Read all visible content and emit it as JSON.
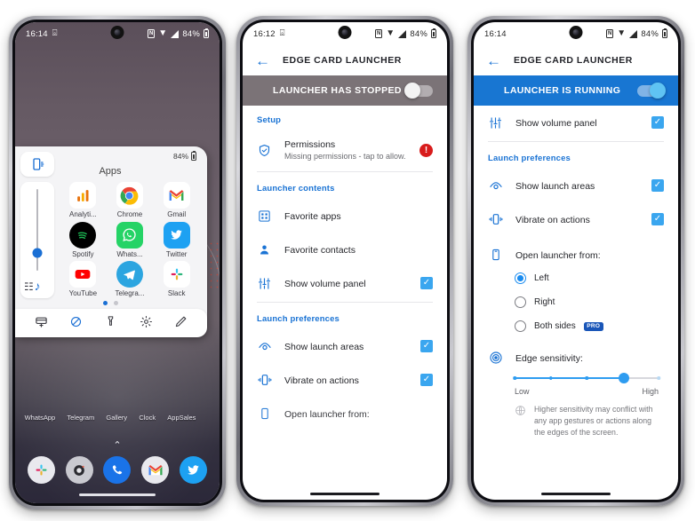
{
  "phone1": {
    "statusbar": {
      "time": "16:14",
      "mail_icon": "gmail-m-icon",
      "nfc": "N",
      "battery_pct": "84%"
    },
    "card": {
      "device_icon": "phone-vibrate-icon",
      "battery_pct": "84%",
      "title": "Apps",
      "volume": {
        "icon": "music-note-icon",
        "eq_icon": "equalizer-icon",
        "level_pct": 22
      },
      "apps": [
        {
          "label": "Analyti...",
          "icon": "google-analytics-icon"
        },
        {
          "label": "Chrome",
          "icon": "chrome-icon"
        },
        {
          "label": "Gmail",
          "icon": "gmail-icon"
        },
        {
          "label": "Spotify",
          "icon": "spotify-icon"
        },
        {
          "label": "Whats...",
          "icon": "whatsapp-icon"
        },
        {
          "label": "Twitter",
          "icon": "twitter-icon"
        },
        {
          "label": "YouTube",
          "icon": "youtube-icon"
        },
        {
          "label": "Telegra...",
          "icon": "telegram-icon"
        },
        {
          "label": "Slack",
          "icon": "slack-icon"
        }
      ],
      "page_dots": {
        "count": 2,
        "active": 0
      },
      "quick_actions": [
        {
          "label": "WhatsApp",
          "icon": "card-add-icon"
        },
        {
          "label": "Telegram",
          "icon": "rotation-lock-icon"
        },
        {
          "label": "Gallery",
          "icon": "flashlight-icon"
        },
        {
          "label": "Clock",
          "icon": "gear-icon"
        },
        {
          "label": "AppSales",
          "icon": "pencil-icon"
        }
      ]
    },
    "home": {
      "chevron": "⌃",
      "dock": [
        {
          "icon": "slack-icon"
        },
        {
          "icon": "camera-icon"
        },
        {
          "icon": "phone-icon"
        },
        {
          "icon": "gmail-icon"
        },
        {
          "icon": "twitter-icon"
        }
      ]
    }
  },
  "phone2": {
    "statusbar": {
      "time": "16:12",
      "mail_icon": "gmail-m-icon",
      "nfc": "N",
      "battery_pct": "84%"
    },
    "appbar": {
      "back_icon": "back-arrow-icon",
      "title": "EDGE CARD LAUNCHER"
    },
    "master_toggle": {
      "label": "LAUNCHER HAS STOPPED",
      "state": "off",
      "color": "#7b7377"
    },
    "sections": [
      {
        "heading": "Setup",
        "rows": [
          {
            "icon": "shield-check-icon",
            "title": "Permissions",
            "subtitle": "Missing permissions - tap to allow.",
            "badge": "!"
          }
        ]
      },
      {
        "heading": "Launcher contents",
        "rows": [
          {
            "icon": "grid-apps-icon",
            "title": "Favorite apps"
          },
          {
            "icon": "person-icon",
            "title": "Favorite contacts"
          },
          {
            "icon": "sliders-icon",
            "title": "Show volume panel",
            "checked": true
          }
        ]
      },
      {
        "heading": "Launch preferences",
        "rows": [
          {
            "icon": "eye-icon",
            "title": "Show launch areas",
            "checked": true
          },
          {
            "icon": "vibrate-icon",
            "title": "Vibrate on actions",
            "checked": true
          },
          {
            "icon": "phone-outline-icon",
            "title": "Open launcher from:"
          }
        ]
      }
    ]
  },
  "phone3": {
    "statusbar": {
      "time": "16:14",
      "nfc": "N",
      "battery_pct": "84%"
    },
    "appbar": {
      "back_icon": "back-arrow-icon",
      "title": "EDGE CARD LAUNCHER"
    },
    "master_toggle": {
      "label": "LAUNCHER IS RUNNING",
      "state": "on",
      "color": "#1876d2"
    },
    "top_row": {
      "icon": "sliders-icon",
      "title": "Show volume panel",
      "checked": true
    },
    "section_heading": "Launch preferences",
    "rows": [
      {
        "icon": "eye-icon",
        "title": "Show launch areas",
        "checked": true
      },
      {
        "icon": "vibrate-icon",
        "title": "Vibrate on actions",
        "checked": true
      }
    ],
    "open_from": {
      "icon": "phone-outline-icon",
      "title": "Open launcher from:",
      "options": [
        {
          "label": "Left",
          "selected": true
        },
        {
          "label": "Right",
          "selected": false
        },
        {
          "label": "Both sides",
          "selected": false,
          "badge": "PRO"
        }
      ]
    },
    "edge_sensitivity": {
      "icon": "target-icon",
      "title": "Edge sensitivity:",
      "low_label": "Low",
      "high_label": "High",
      "value_pct": 76,
      "ticks_pct": [
        0,
        25,
        50,
        76,
        100
      ],
      "hint_icon": "info-globe-icon",
      "hint": "Higher sensitivity may conflict with any app gestures or actions along the edges of the screen."
    }
  },
  "colors": {
    "accent_blue": "#1a73d4",
    "running_blue": "#1876d2",
    "stopped_gray": "#7b7377",
    "checkbox_blue": "#3aa6ef",
    "alert_red": "#d81c1c"
  }
}
